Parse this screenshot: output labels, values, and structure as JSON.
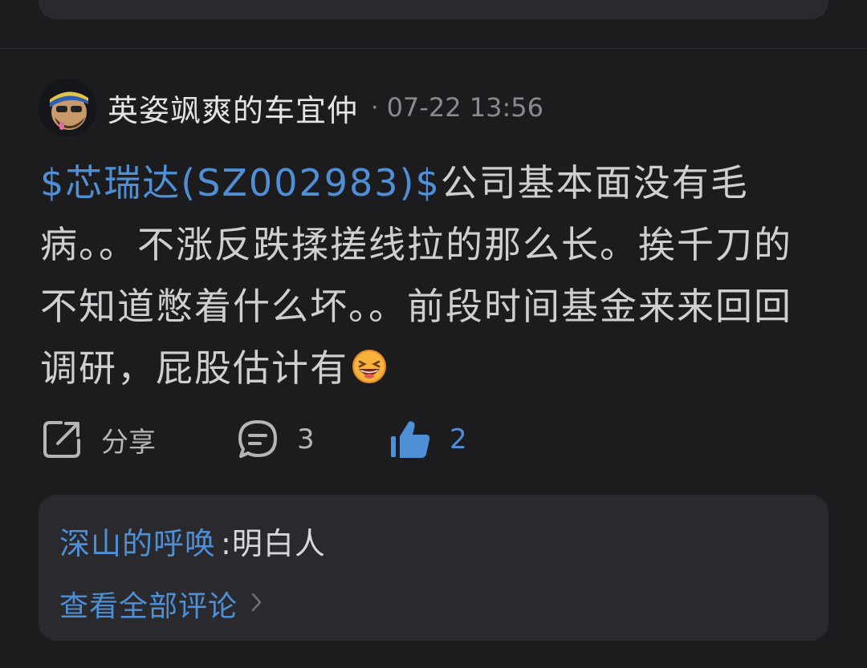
{
  "post": {
    "author": "英姿飒爽的车宜仲",
    "separator_dot": "·",
    "time": "07-22 13:56",
    "stock_tag": "$芯瑞达(SZ002983)$",
    "body_text": "公司基本面没有毛病。。不涨反跌揉搓线拉的那么长。挨千刀的不知道憋着什么坏。。前段时间基金来来回回调研，屁股估计有",
    "emoji": "laughing-face-icon"
  },
  "actions": {
    "share_label": "分享",
    "comment_count": "3",
    "like_count": "2"
  },
  "comments": {
    "commenter": "深山的呼唤",
    "colon": ":",
    "text": "明白人",
    "view_all": "查看全部评论"
  },
  "colors": {
    "background": "#1c1c1e",
    "card": "#2a2a2e",
    "accent": "#4f8fd6",
    "text": "#cfcfd2",
    "muted": "#8a8a8e"
  }
}
